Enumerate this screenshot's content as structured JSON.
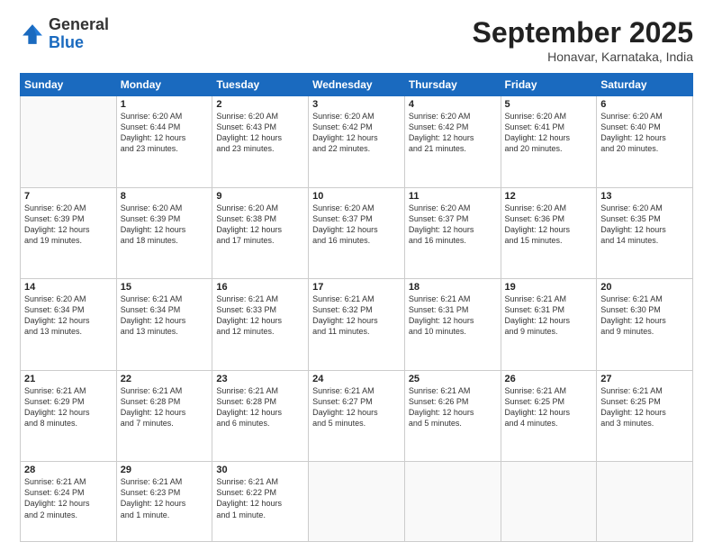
{
  "logo": {
    "general": "General",
    "blue": "Blue"
  },
  "title": {
    "month_year": "September 2025",
    "location": "Honavar, Karnataka, India"
  },
  "header_days": [
    "Sunday",
    "Monday",
    "Tuesday",
    "Wednesday",
    "Thursday",
    "Friday",
    "Saturday"
  ],
  "weeks": [
    [
      {
        "day": "",
        "info": ""
      },
      {
        "day": "1",
        "info": "Sunrise: 6:20 AM\nSunset: 6:44 PM\nDaylight: 12 hours\nand 23 minutes."
      },
      {
        "day": "2",
        "info": "Sunrise: 6:20 AM\nSunset: 6:43 PM\nDaylight: 12 hours\nand 23 minutes."
      },
      {
        "day": "3",
        "info": "Sunrise: 6:20 AM\nSunset: 6:42 PM\nDaylight: 12 hours\nand 22 minutes."
      },
      {
        "day": "4",
        "info": "Sunrise: 6:20 AM\nSunset: 6:42 PM\nDaylight: 12 hours\nand 21 minutes."
      },
      {
        "day": "5",
        "info": "Sunrise: 6:20 AM\nSunset: 6:41 PM\nDaylight: 12 hours\nand 20 minutes."
      },
      {
        "day": "6",
        "info": "Sunrise: 6:20 AM\nSunset: 6:40 PM\nDaylight: 12 hours\nand 20 minutes."
      }
    ],
    [
      {
        "day": "7",
        "info": "Sunrise: 6:20 AM\nSunset: 6:39 PM\nDaylight: 12 hours\nand 19 minutes."
      },
      {
        "day": "8",
        "info": "Sunrise: 6:20 AM\nSunset: 6:39 PM\nDaylight: 12 hours\nand 18 minutes."
      },
      {
        "day": "9",
        "info": "Sunrise: 6:20 AM\nSunset: 6:38 PM\nDaylight: 12 hours\nand 17 minutes."
      },
      {
        "day": "10",
        "info": "Sunrise: 6:20 AM\nSunset: 6:37 PM\nDaylight: 12 hours\nand 16 minutes."
      },
      {
        "day": "11",
        "info": "Sunrise: 6:20 AM\nSunset: 6:37 PM\nDaylight: 12 hours\nand 16 minutes."
      },
      {
        "day": "12",
        "info": "Sunrise: 6:20 AM\nSunset: 6:36 PM\nDaylight: 12 hours\nand 15 minutes."
      },
      {
        "day": "13",
        "info": "Sunrise: 6:20 AM\nSunset: 6:35 PM\nDaylight: 12 hours\nand 14 minutes."
      }
    ],
    [
      {
        "day": "14",
        "info": "Sunrise: 6:20 AM\nSunset: 6:34 PM\nDaylight: 12 hours\nand 13 minutes."
      },
      {
        "day": "15",
        "info": "Sunrise: 6:21 AM\nSunset: 6:34 PM\nDaylight: 12 hours\nand 13 minutes."
      },
      {
        "day": "16",
        "info": "Sunrise: 6:21 AM\nSunset: 6:33 PM\nDaylight: 12 hours\nand 12 minutes."
      },
      {
        "day": "17",
        "info": "Sunrise: 6:21 AM\nSunset: 6:32 PM\nDaylight: 12 hours\nand 11 minutes."
      },
      {
        "day": "18",
        "info": "Sunrise: 6:21 AM\nSunset: 6:31 PM\nDaylight: 12 hours\nand 10 minutes."
      },
      {
        "day": "19",
        "info": "Sunrise: 6:21 AM\nSunset: 6:31 PM\nDaylight: 12 hours\nand 9 minutes."
      },
      {
        "day": "20",
        "info": "Sunrise: 6:21 AM\nSunset: 6:30 PM\nDaylight: 12 hours\nand 9 minutes."
      }
    ],
    [
      {
        "day": "21",
        "info": "Sunrise: 6:21 AM\nSunset: 6:29 PM\nDaylight: 12 hours\nand 8 minutes."
      },
      {
        "day": "22",
        "info": "Sunrise: 6:21 AM\nSunset: 6:28 PM\nDaylight: 12 hours\nand 7 minutes."
      },
      {
        "day": "23",
        "info": "Sunrise: 6:21 AM\nSunset: 6:28 PM\nDaylight: 12 hours\nand 6 minutes."
      },
      {
        "day": "24",
        "info": "Sunrise: 6:21 AM\nSunset: 6:27 PM\nDaylight: 12 hours\nand 5 minutes."
      },
      {
        "day": "25",
        "info": "Sunrise: 6:21 AM\nSunset: 6:26 PM\nDaylight: 12 hours\nand 5 minutes."
      },
      {
        "day": "26",
        "info": "Sunrise: 6:21 AM\nSunset: 6:25 PM\nDaylight: 12 hours\nand 4 minutes."
      },
      {
        "day": "27",
        "info": "Sunrise: 6:21 AM\nSunset: 6:25 PM\nDaylight: 12 hours\nand 3 minutes."
      }
    ],
    [
      {
        "day": "28",
        "info": "Sunrise: 6:21 AM\nSunset: 6:24 PM\nDaylight: 12 hours\nand 2 minutes."
      },
      {
        "day": "29",
        "info": "Sunrise: 6:21 AM\nSunset: 6:23 PM\nDaylight: 12 hours\nand 1 minute."
      },
      {
        "day": "30",
        "info": "Sunrise: 6:21 AM\nSunset: 6:22 PM\nDaylight: 12 hours\nand 1 minute."
      },
      {
        "day": "",
        "info": ""
      },
      {
        "day": "",
        "info": ""
      },
      {
        "day": "",
        "info": ""
      },
      {
        "day": "",
        "info": ""
      }
    ]
  ]
}
